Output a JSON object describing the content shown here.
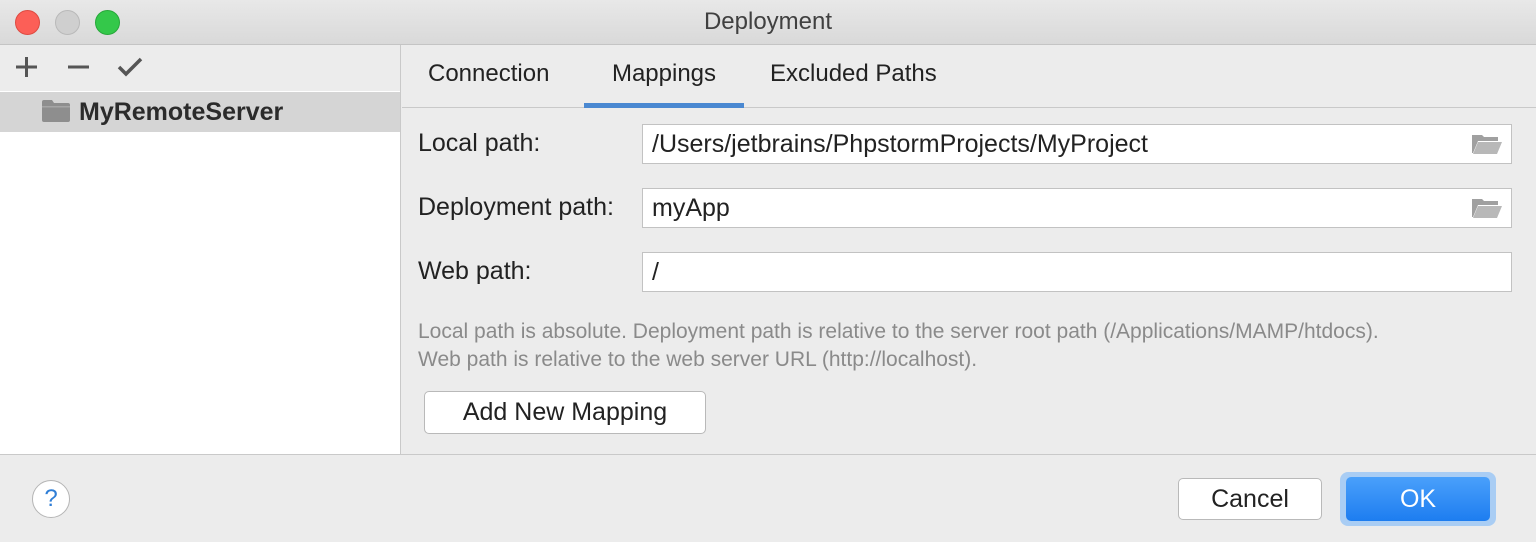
{
  "window": {
    "title": "Deployment"
  },
  "sidebar": {
    "toolbar": {
      "add": "plus-icon",
      "remove": "minus-icon",
      "apply": "checkmark-icon"
    },
    "servers": [
      {
        "label": "MyRemoteServer",
        "icon": "folder-icon",
        "selected": true
      }
    ]
  },
  "tabs": [
    {
      "label": "Connection",
      "selected": false
    },
    {
      "label": "Mappings",
      "selected": true
    },
    {
      "label": "Excluded Paths",
      "selected": false
    }
  ],
  "form": {
    "local_path": {
      "label": "Local path:",
      "value": "/Users/jetbrains/PhpstormProjects/MyProject"
    },
    "deployment_path": {
      "label": "Deployment path:",
      "value": "myApp"
    },
    "web_path": {
      "label": "Web path:",
      "value": "/"
    }
  },
  "hint": {
    "line1": "Local path is absolute. Deployment path is relative to the server root path (/Applications/MAMP/htdocs).",
    "line2": "Web path is relative to the web server URL (http://localhost)."
  },
  "buttons": {
    "add_mapping": "Add New Mapping",
    "cancel": "Cancel",
    "ok": "OK",
    "help": "?"
  },
  "colors": {
    "accent": "#4a88d1",
    "ok_button": "#1d7df0",
    "close": "#fc5f57",
    "maximize": "#34c84a"
  }
}
